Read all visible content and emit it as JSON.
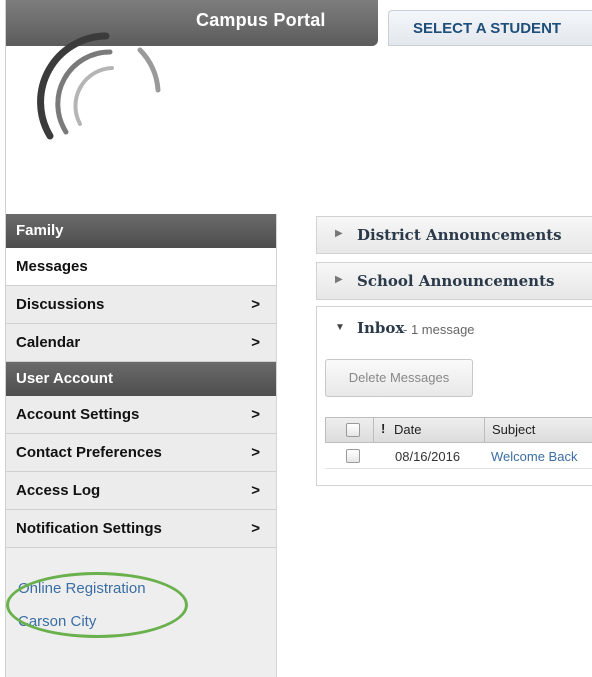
{
  "header": {
    "portal_title": "Campus Portal",
    "select_student": "SELECT A STUDENT"
  },
  "sidebar": {
    "family_header": "Family",
    "family_items": [
      {
        "label": "Messages",
        "active": true
      },
      {
        "label": "Discussions",
        "chevron": ">"
      },
      {
        "label": "Calendar",
        "chevron": ">"
      }
    ],
    "account_header": "User Account",
    "account_items": [
      {
        "label": "Account Settings",
        "chevron": ">"
      },
      {
        "label": "Contact Preferences",
        "chevron": ">"
      },
      {
        "label": "Access Log",
        "chevron": ">"
      },
      {
        "label": "Notification Settings",
        "chevron": ">"
      }
    ],
    "links": [
      "Online Registration",
      "Carson City"
    ]
  },
  "main": {
    "district_announcements": "District Announcements",
    "school_announcements": "School Announcements",
    "inbox": {
      "title": "Inbox",
      "count": "- 1 message",
      "delete_button": "Delete Messages",
      "columns": {
        "flag": "!",
        "date": "Date",
        "subject": "Subject"
      },
      "rows": [
        {
          "date": "08/16/2016",
          "subject": "Welcome Back"
        }
      ]
    }
  },
  "colors": {
    "accent_link": "#3a6ea5",
    "header_gray": "#5c5c5c",
    "highlight_ring": "#6ab04c"
  }
}
